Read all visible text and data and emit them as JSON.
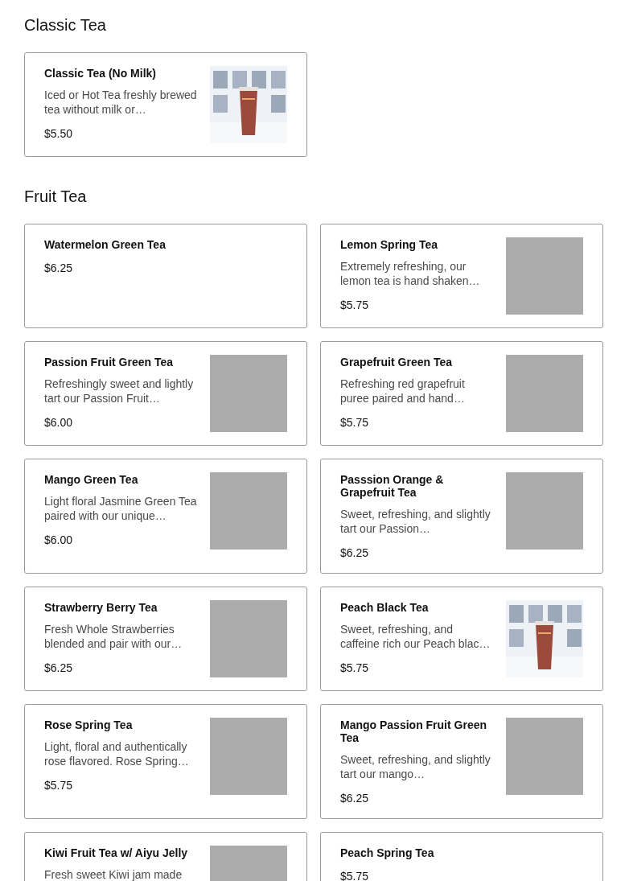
{
  "sections": [
    {
      "title": "Classic Tea",
      "items": [
        {
          "name": "Classic Tea (No Milk)",
          "description": "Iced or Hot Tea freshly brewed tea without milk or…",
          "price": "$5.50"
        }
      ]
    },
    {
      "title": "Fruit Tea",
      "items": [
        {
          "kind": "plain",
          "name": "Watermelon Green Tea",
          "price": "$6.25"
        },
        {
          "kind": "placeholder",
          "name": "Lemon Spring Tea",
          "description": "Extremely refreshing, our lemon tea is hand shaken…",
          "price": "$5.75"
        },
        {
          "kind": "placeholder",
          "name": "Passion Fruit Green Tea",
          "description": "Refreshingly sweet and lightly tart our Passion Fruit…",
          "price": "$6.00"
        },
        {
          "kind": "placeholder",
          "name": "Grapefruit Green Tea",
          "description": "Refreshing red grapefruit puree paired and hand…",
          "price": "$5.75"
        },
        {
          "kind": "placeholder",
          "name": "Mango Green Tea",
          "description": "Light floral Jasmine Green Tea paired with our unique…",
          "price": "$6.00"
        },
        {
          "kind": "placeholder",
          "name": "Passsion Orange & Grapefruit Tea",
          "description": "Sweet, refreshing, and slightly tart our Passion…",
          "price": "$6.25"
        },
        {
          "kind": "placeholder",
          "name": "Strawberry Berry Tea",
          "description": "Fresh Whole Strawberries blended and pair with our…",
          "price": "$6.25"
        },
        {
          "name": "Peach Black Tea",
          "description": "Sweet, refreshing, and caffeine rich our Peach blac…",
          "price": "$5.75"
        },
        {
          "kind": "placeholder",
          "name": "Rose Spring Tea",
          "description": "Light, floral and authentically rose flavored. Rose Spring…",
          "price": "$5.75"
        },
        {
          "kind": "placeholder",
          "name": "Mango Passion Fruit Green Tea",
          "description": "Sweet, refreshing, and slightly tart our mango…",
          "price": "$6.25"
        },
        {
          "kind": "placeholder",
          "name": "Kiwi Fruit Tea w/ Aiyu Jelly",
          "description": "Fresh sweet Kiwi jam made"
        },
        {
          "kind": "plain",
          "name": "Peach Spring Tea",
          "price": "$5.75"
        }
      ]
    }
  ]
}
